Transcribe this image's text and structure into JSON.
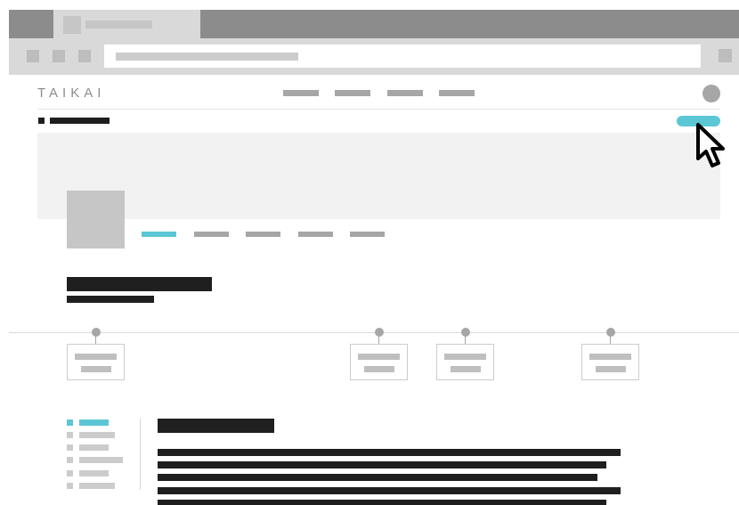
{
  "site": {
    "logo_text": "TAIKAI"
  },
  "icons": {
    "cursor": "pointer-cursor-icon",
    "avatar": "user-avatar-icon",
    "breadcrumb": "square-bullet-icon"
  },
  "colors": {
    "accent": "#5bc7d4",
    "dark_text_block": "#1f1f1f",
    "placeholder": "#a6a6a6",
    "browser_chrome": "#8c8c8c",
    "toolbar": "#d9d9d9"
  },
  "profile_tabs": {
    "active_index": 0,
    "count": 5
  },
  "timeline": {
    "card_count": 4
  },
  "side_menu": {
    "active_index": 0,
    "count": 6
  }
}
